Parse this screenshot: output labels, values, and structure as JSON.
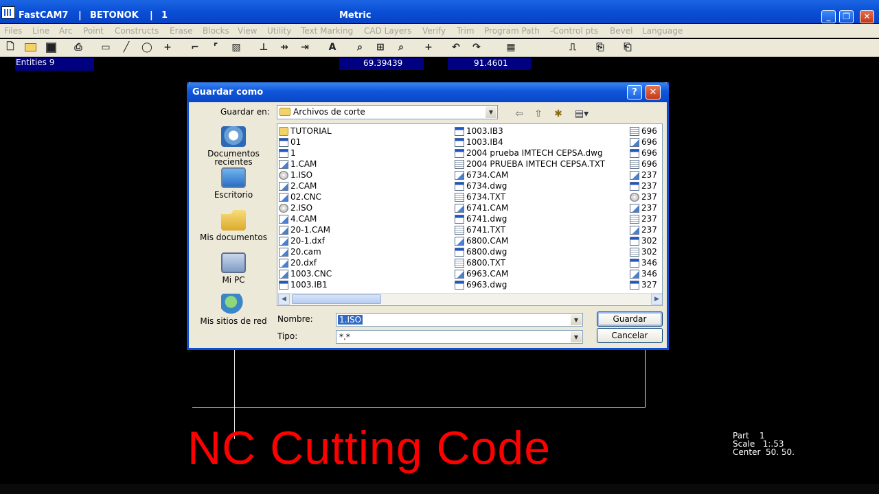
{
  "window": {
    "app": "FastCAM7",
    "project": "BETONOK",
    "part_no": "1",
    "units": "Metric",
    "minimize": "_",
    "restore": "❐",
    "close": "✕"
  },
  "menu": [
    "Files",
    "Line",
    "Arc",
    "Point",
    "Constructs",
    "Erase",
    "Blocks",
    "View",
    "Utility",
    "Text Marking",
    "CAD Layers",
    "Verify",
    "Trim",
    "Program Path",
    "-Control pts",
    "Bevel",
    "Language"
  ],
  "status": {
    "entities": "Entities  9",
    "x": "69.39439",
    "y": "91.4601"
  },
  "dialog": {
    "title": "Guardar como",
    "help": "?",
    "close": "✕",
    "save_in_label": "Guardar en:",
    "save_in_value": "Archivos de corte",
    "places": [
      {
        "label": "Documentos recientes"
      },
      {
        "label": "Escritorio"
      },
      {
        "label": "Mis documentos"
      },
      {
        "label": "Mi PC"
      },
      {
        "label": "Mis sitios de red"
      }
    ],
    "files_col1": [
      {
        "name": "TUTORIAL",
        "icon": "folder"
      },
      {
        "name": "01",
        "icon": "app"
      },
      {
        "name": "1",
        "icon": "app"
      },
      {
        "name": "1.CAM",
        "icon": "doc"
      },
      {
        "name": "1.ISO",
        "icon": "cd"
      },
      {
        "name": "2.CAM",
        "icon": "doc"
      },
      {
        "name": "02.CNC",
        "icon": "doc"
      },
      {
        "name": "2.ISO",
        "icon": "cd"
      },
      {
        "name": "4.CAM",
        "icon": "doc"
      },
      {
        "name": "20-1.CAM",
        "icon": "doc"
      },
      {
        "name": "20-1.dxf",
        "icon": "doc"
      },
      {
        "name": "20.cam",
        "icon": "doc"
      },
      {
        "name": "20.dxf",
        "icon": "doc"
      },
      {
        "name": "1003.CNC",
        "icon": "doc"
      },
      {
        "name": "1003.IB1",
        "icon": "app"
      }
    ],
    "files_col2": [
      {
        "name": "1003.IB3",
        "icon": "app"
      },
      {
        "name": "1003.IB4",
        "icon": "app"
      },
      {
        "name": "2004 prueba IMTECH CEPSA.dwg",
        "icon": "app"
      },
      {
        "name": "2004 PRUEBA IMTECH CEPSA.TXT",
        "icon": "txt"
      },
      {
        "name": "6734.CAM",
        "icon": "doc"
      },
      {
        "name": "6734.dwg",
        "icon": "app"
      },
      {
        "name": "6734.TXT",
        "icon": "txt"
      },
      {
        "name": "6741.CAM",
        "icon": "doc"
      },
      {
        "name": "6741.dwg",
        "icon": "app"
      },
      {
        "name": "6741.TXT",
        "icon": "txt"
      },
      {
        "name": "6800.CAM",
        "icon": "doc"
      },
      {
        "name": "6800.dwg",
        "icon": "app"
      },
      {
        "name": "6800.TXT",
        "icon": "txt"
      },
      {
        "name": "6963.CAM",
        "icon": "doc"
      },
      {
        "name": "6963.dwg",
        "icon": "app"
      }
    ],
    "files_col3": [
      {
        "name": "696",
        "icon": "txt"
      },
      {
        "name": "696",
        "icon": "doc"
      },
      {
        "name": "696",
        "icon": "app"
      },
      {
        "name": "696",
        "icon": "txt"
      },
      {
        "name": "237",
        "icon": "doc"
      },
      {
        "name": "237",
        "icon": "app"
      },
      {
        "name": "237",
        "icon": "cd"
      },
      {
        "name": "237",
        "icon": "doc"
      },
      {
        "name": "237",
        "icon": "txt"
      },
      {
        "name": "237",
        "icon": "doc"
      },
      {
        "name": "302",
        "icon": "app"
      },
      {
        "name": "302",
        "icon": "txt"
      },
      {
        "name": "346",
        "icon": "app"
      },
      {
        "name": "346",
        "icon": "doc"
      },
      {
        "name": "327",
        "icon": "app"
      }
    ],
    "name_label": "Nombre:",
    "name_value": "1.ISO",
    "type_label": "Tipo:",
    "type_value": "*.*",
    "save_button": "Guardar",
    "cancel_button": "Cancelar"
  },
  "canvas": {
    "caption": "NC Cutting Code",
    "part_info": "Part    1\nScale   1:.53\nCenter  50. 50."
  },
  "colors": {
    "caption": "#ff0000",
    "panel": "#000080",
    "titlebar": "#0a4fd6"
  }
}
